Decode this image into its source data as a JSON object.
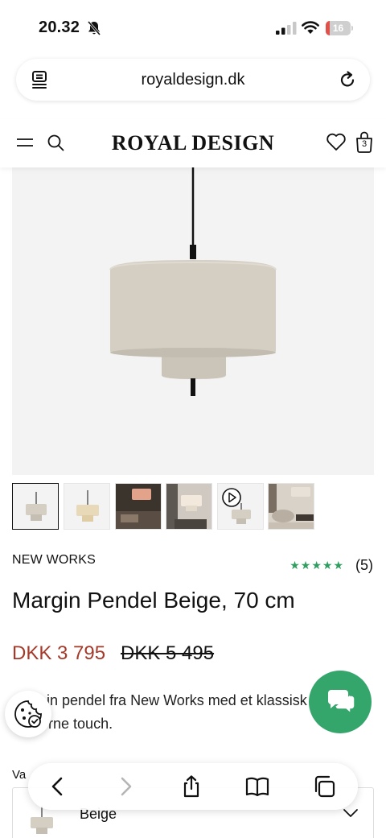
{
  "status_bar": {
    "time": "20.32",
    "battery": "16",
    "battery_level": 0.16,
    "battery_color": "#e0514a"
  },
  "browser": {
    "url": "royaldesign.dk"
  },
  "site": {
    "logo": "ROYAL DESIGN",
    "cart_count": "3"
  },
  "product": {
    "brand": "NEW WORKS",
    "stars": "★★★★★",
    "rating": 5,
    "review_count": "(5)",
    "title": "Margin Pendel Beige, 70 cm",
    "price": "DKK 3 795",
    "old_price": "DKK 5 495",
    "description": "in pendel fra New Works med et klassisk moderne touch.",
    "variant_label": "Va",
    "variant_value": "Beige"
  },
  "colors": {
    "price_red": "#a33a2a",
    "star_green": "#2f9e5f",
    "chat_green": "#35a66b"
  },
  "icons": [
    "bell-muted-icon",
    "signal-icon",
    "wifi-icon",
    "reader-icon",
    "reload-icon",
    "menu-icon",
    "search-icon",
    "heart-icon",
    "bag-icon",
    "play-icon",
    "cookie-icon",
    "chat-icon",
    "back-icon",
    "forward-icon",
    "share-icon",
    "bookmarks-icon",
    "tabs-icon",
    "chevron-down-icon"
  ]
}
